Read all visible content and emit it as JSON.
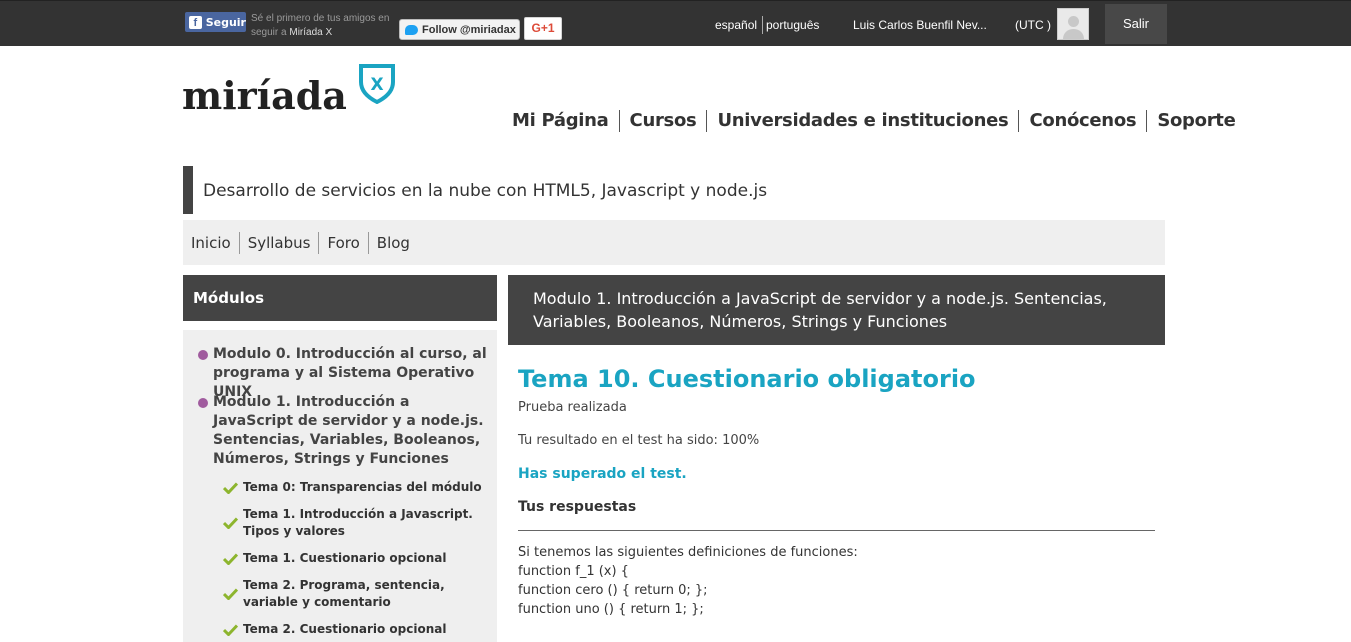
{
  "topbar": {
    "fb_label": "Seguir",
    "fb_note_prefix": "Sé el primero de tus amigos en seguir a",
    "fb_note_brand": "Miríada X",
    "twitter_label": "Follow @miriadax",
    "gplus_label": "G+1",
    "lang_es": "español",
    "lang_pt": "português",
    "user_name": "Luis Carlos Buenfil Nev...",
    "timezone": "(UTC )",
    "logout_label": "Salir"
  },
  "header": {
    "logo_text": "miríada",
    "logo_badge": "X",
    "nav": [
      "Mi Página",
      "Cursos",
      "Universidades e instituciones",
      "Conócenos",
      "Soporte"
    ]
  },
  "course": {
    "title": "Desarrollo de servicios en la nube con HTML5, Javascript y node.js",
    "tabs": [
      "Inicio",
      "Syllabus",
      "Foro",
      "Blog"
    ]
  },
  "sidebar": {
    "heading": "Módulos",
    "modules": [
      "Modulo 0. Introducción al curso, al programa y al Sistema Operativo UNIX",
      "Modulo 1. Introducción a JavaScript de servidor y a node.js. Sentencias, Variables, Booleanos, Números, Strings y Funciones"
    ],
    "topics": [
      "Tema 0: Transparencias del módulo",
      "Tema 1. Introducción a Javascript. Tipos y valores",
      "Tema 1. Cuestionario opcional",
      "Tema 2. Programa, sentencia, variable y comentario",
      "Tema 2. Cuestionario opcional"
    ],
    "accent_color": "#a05b9e",
    "check_color": "#8db52e"
  },
  "main": {
    "module_heading": "Modulo 1. Introducción a JavaScript de servidor y a node.js. Sentencias, Variables, Booleanos, Números, Strings y Funciones",
    "topic_title": "Tema 10. Cuestionario obligatorio",
    "status": "Prueba realizada",
    "result": "Tu resultado en el test ha sido: 100%",
    "pass_message": "Has superado el test.",
    "answers_heading": "Tus respuestas",
    "code_lines": [
      "Si tenemos las siguientes definiciones de funciones:",
      "function f_1 (x) {",
      "function cero () { return 0; };",
      "function uno () { return 1; };"
    ],
    "accent_color": "#1aa4c2"
  }
}
